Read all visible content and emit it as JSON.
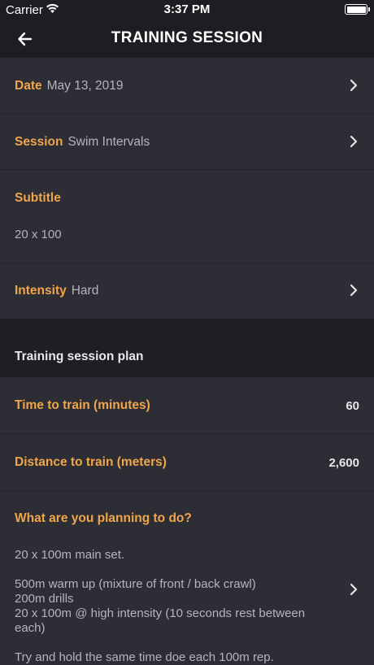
{
  "status_bar": {
    "carrier": "Carrier",
    "time": "3:37 PM"
  },
  "nav": {
    "title": "TRAINING SESSION"
  },
  "rows": {
    "date": {
      "label": "Date",
      "value": "May 13, 2019"
    },
    "session": {
      "label": "Session",
      "value": "Swim Intervals"
    },
    "subtitle": {
      "label": "Subtitle",
      "value": "20 x 100"
    },
    "intensity": {
      "label": "Intensity",
      "value": "Hard"
    }
  },
  "plan": {
    "header": "Training session plan",
    "time": {
      "label": "Time to train (minutes)",
      "value": "60"
    },
    "distance": {
      "label": "Distance to train (meters)",
      "value": "2,600"
    },
    "planning": {
      "label": "What are you planning to do?",
      "line1": "20 x 100m main set.",
      "line2": "500m warm up (mixture of front / back crawl)",
      "line3": "200m drills",
      "line4": "20 x 100m @ high intensity (10 seconds rest between each)",
      "line5": "Try and hold the same time doe each 100m rep."
    }
  },
  "colors": {
    "accent": "#f0a64a",
    "background": "#2d2d35",
    "header_bg": "#1d1d22"
  }
}
